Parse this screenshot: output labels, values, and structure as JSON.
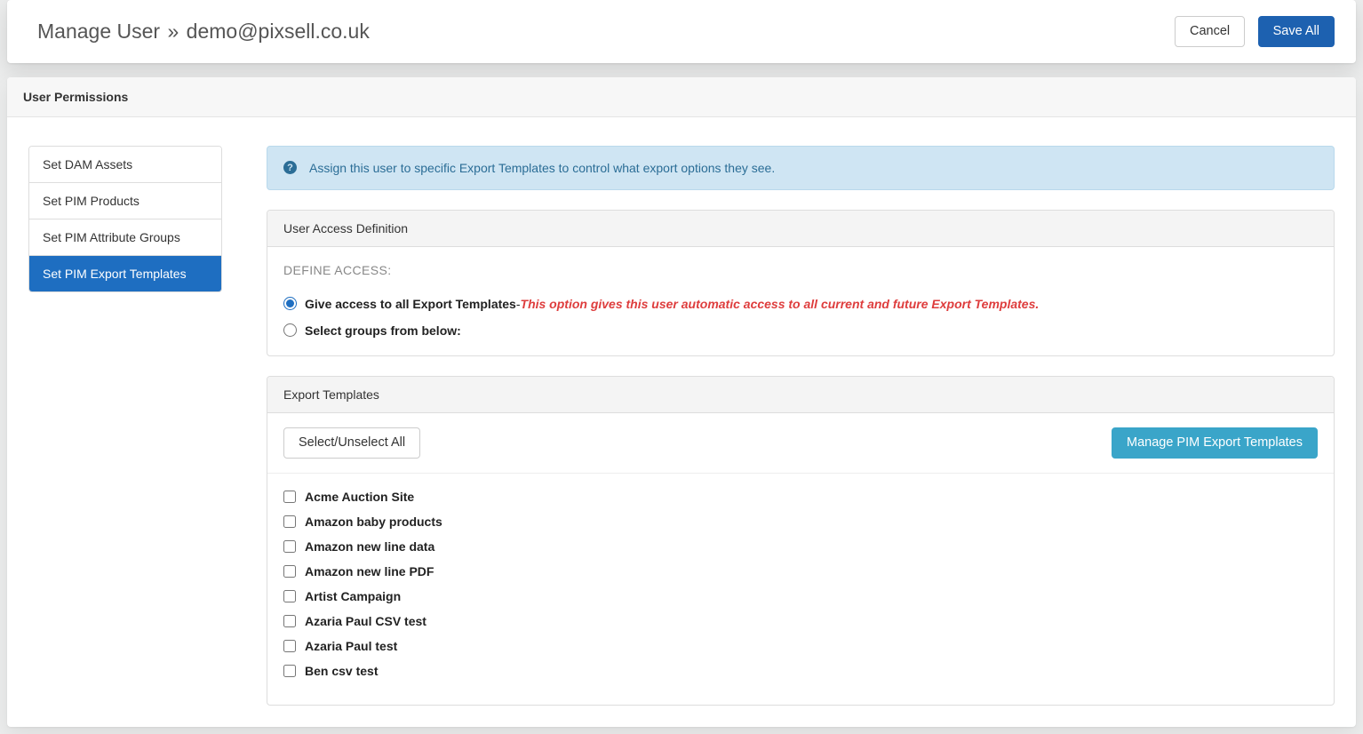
{
  "header": {
    "title_prefix": "Manage User",
    "title_separator": "»",
    "user_email": "demo@pixsell.co.uk",
    "cancel_label": "Cancel",
    "save_label": "Save All"
  },
  "section": {
    "title": "User Permissions"
  },
  "nav": {
    "items": [
      {
        "label": "Set DAM Assets",
        "active": false
      },
      {
        "label": "Set PIM Products",
        "active": false
      },
      {
        "label": "Set PIM Attribute Groups",
        "active": false
      },
      {
        "label": "Set PIM Export Templates",
        "active": true
      }
    ]
  },
  "info_banner": {
    "text": "Assign this user to specific Export Templates to control what export options they see."
  },
  "access_panel": {
    "title": "User Access Definition",
    "define_label": "DEFINE ACCESS:",
    "option_all_label": "Give access to all Export Templates",
    "option_all_dash": " - ",
    "option_all_note": "This option gives this user automatic access to all current and future Export Templates.",
    "option_select_label": "Select groups from below:",
    "selected": "all"
  },
  "templates_panel": {
    "title": "Export Templates",
    "select_all_label": "Select/Unselect All",
    "manage_label": "Manage PIM Export Templates",
    "items": [
      {
        "label": "Acme Auction Site",
        "checked": false
      },
      {
        "label": "Amazon baby products",
        "checked": false
      },
      {
        "label": "Amazon new line data",
        "checked": false
      },
      {
        "label": "Amazon new line PDF",
        "checked": false
      },
      {
        "label": "Artist Campaign",
        "checked": false
      },
      {
        "label": "Azaria Paul CSV test",
        "checked": false
      },
      {
        "label": "Azaria Paul test",
        "checked": false
      },
      {
        "label": "Ben csv test",
        "checked": false
      }
    ]
  }
}
